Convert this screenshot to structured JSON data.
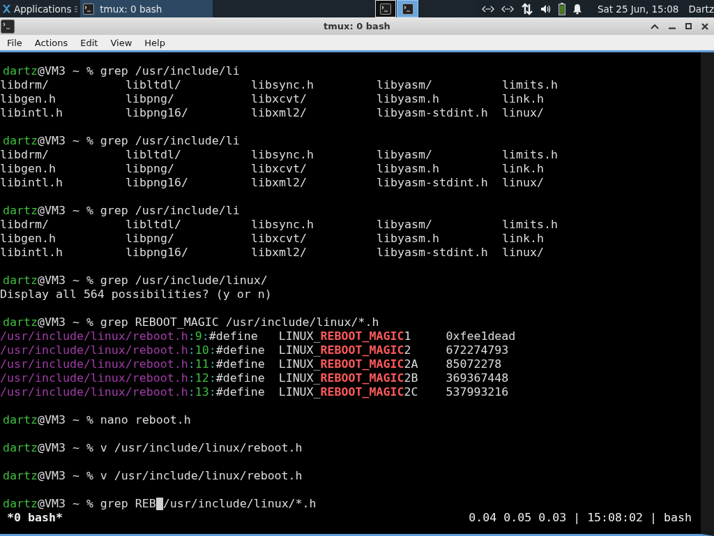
{
  "panel": {
    "app_menu": "Applications",
    "tasks": [
      {
        "title": "tmux: 0 bash",
        "selected": true
      }
    ],
    "workspaces": [
      {
        "selected": false
      },
      {
        "selected": true
      }
    ],
    "clock": "Sat 25 Jun, 15:08",
    "user": "Dartz"
  },
  "window": {
    "title": "tmux: 0 bash",
    "menu": [
      "File",
      "Actions",
      "Edit",
      "View",
      "Help"
    ]
  },
  "terminal": {
    "lines": [
      {
        "kind": "text",
        "segments": [
          {
            "kind": "user",
            "text": "dartz"
          },
          {
            "kind": "plain",
            "text": "@VM3 ~ % grep /usr/include/li"
          }
        ]
      },
      {
        "kind": "listing",
        "cells": [
          "libdrm/",
          "libltdl/",
          "libsync.h",
          "libyasm/",
          "limits.h"
        ]
      },
      {
        "kind": "listing",
        "cells": [
          "libgen.h",
          "libpng/",
          "libxcvt/",
          "libyasm.h",
          "link.h"
        ]
      },
      {
        "kind": "listing",
        "cells": [
          "libintl.h",
          "libpng16/",
          "libxml2/",
          "libyasm-stdint.h",
          "linux/"
        ]
      },
      {
        "kind": "blank"
      },
      {
        "kind": "text",
        "segments": [
          {
            "kind": "user",
            "text": "dartz"
          },
          {
            "kind": "plain",
            "text": "@VM3 ~ % grep /usr/include/li"
          }
        ]
      },
      {
        "kind": "listing",
        "cells": [
          "libdrm/",
          "libltdl/",
          "libsync.h",
          "libyasm/",
          "limits.h"
        ]
      },
      {
        "kind": "listing",
        "cells": [
          "libgen.h",
          "libpng/",
          "libxcvt/",
          "libyasm.h",
          "link.h"
        ]
      },
      {
        "kind": "listing",
        "cells": [
          "libintl.h",
          "libpng16/",
          "libxml2/",
          "libyasm-stdint.h",
          "linux/"
        ]
      },
      {
        "kind": "blank"
      },
      {
        "kind": "text",
        "segments": [
          {
            "kind": "user",
            "text": "dartz"
          },
          {
            "kind": "plain",
            "text": "@VM3 ~ % grep /usr/include/li"
          }
        ]
      },
      {
        "kind": "listing",
        "cells": [
          "libdrm/",
          "libltdl/",
          "libsync.h",
          "libyasm/",
          "limits.h"
        ]
      },
      {
        "kind": "listing",
        "cells": [
          "libgen.h",
          "libpng/",
          "libxcvt/",
          "libyasm.h",
          "link.h"
        ]
      },
      {
        "kind": "listing",
        "cells": [
          "libintl.h",
          "libpng16/",
          "libxml2/",
          "libyasm-stdint.h",
          "linux/"
        ]
      },
      {
        "kind": "blank"
      },
      {
        "kind": "text",
        "segments": [
          {
            "kind": "user",
            "text": "dartz"
          },
          {
            "kind": "plain",
            "text": "@VM3 ~ % grep /usr/include/linux/"
          }
        ]
      },
      {
        "kind": "text",
        "segments": [
          {
            "kind": "plain",
            "text": "Display all 564 possibilities? (y or n)"
          }
        ]
      },
      {
        "kind": "blank"
      },
      {
        "kind": "text",
        "segments": [
          {
            "kind": "user",
            "text": "dartz"
          },
          {
            "kind": "plain",
            "text": "@VM3 ~ % grep REBOOT_MAGIC /usr/include/linux/*.h"
          }
        ]
      },
      {
        "kind": "text",
        "segments": [
          {
            "kind": "path",
            "text": "/usr/include/linux/reboot.h"
          },
          {
            "kind": "sep",
            "text": ":"
          },
          {
            "kind": "linenum",
            "text": "9"
          },
          {
            "kind": "sep",
            "text": ":"
          },
          {
            "kind": "plain",
            "text": "#define   LINUX_"
          },
          {
            "kind": "match",
            "text": "REBOOT_MAGIC"
          },
          {
            "kind": "plain",
            "text": "1     0xfee1dead"
          }
        ]
      },
      {
        "kind": "text",
        "segments": [
          {
            "kind": "path",
            "text": "/usr/include/linux/reboot.h"
          },
          {
            "kind": "sep",
            "text": ":"
          },
          {
            "kind": "linenum",
            "text": "10"
          },
          {
            "kind": "sep",
            "text": ":"
          },
          {
            "kind": "plain",
            "text": "#define  LINUX_"
          },
          {
            "kind": "match",
            "text": "REBOOT_MAGIC"
          },
          {
            "kind": "plain",
            "text": "2     672274793"
          }
        ]
      },
      {
        "kind": "text",
        "segments": [
          {
            "kind": "path",
            "text": "/usr/include/linux/reboot.h"
          },
          {
            "kind": "sep",
            "text": ":"
          },
          {
            "kind": "linenum",
            "text": "11"
          },
          {
            "kind": "sep",
            "text": ":"
          },
          {
            "kind": "plain",
            "text": "#define  LINUX_"
          },
          {
            "kind": "match",
            "text": "REBOOT_MAGIC"
          },
          {
            "kind": "plain",
            "text": "2A    85072278"
          }
        ]
      },
      {
        "kind": "text",
        "segments": [
          {
            "kind": "path",
            "text": "/usr/include/linux/reboot.h"
          },
          {
            "kind": "sep",
            "text": ":"
          },
          {
            "kind": "linenum",
            "text": "12"
          },
          {
            "kind": "sep",
            "text": ":"
          },
          {
            "kind": "plain",
            "text": "#define  LINUX_"
          },
          {
            "kind": "match",
            "text": "REBOOT_MAGIC"
          },
          {
            "kind": "plain",
            "text": "2B    369367448"
          }
        ]
      },
      {
        "kind": "text",
        "segments": [
          {
            "kind": "path",
            "text": "/usr/include/linux/reboot.h"
          },
          {
            "kind": "sep",
            "text": ":"
          },
          {
            "kind": "linenum",
            "text": "13"
          },
          {
            "kind": "sep",
            "text": ":"
          },
          {
            "kind": "plain",
            "text": "#define  LINUX_"
          },
          {
            "kind": "match",
            "text": "REBOOT_MAGIC"
          },
          {
            "kind": "plain",
            "text": "2C    537993216"
          }
        ]
      },
      {
        "kind": "blank"
      },
      {
        "kind": "text",
        "segments": [
          {
            "kind": "user",
            "text": "dartz"
          },
          {
            "kind": "plain",
            "text": "@VM3 ~ % nano reboot.h"
          }
        ]
      },
      {
        "kind": "blank"
      },
      {
        "kind": "text",
        "segments": [
          {
            "kind": "user",
            "text": "dartz"
          },
          {
            "kind": "plain",
            "text": "@VM3 ~ % v /usr/include/linux/reboot.h"
          }
        ]
      },
      {
        "kind": "blank"
      },
      {
        "kind": "text",
        "segments": [
          {
            "kind": "user",
            "text": "dartz"
          },
          {
            "kind": "plain",
            "text": "@VM3 ~ % v /usr/include/linux/reboot.h"
          }
        ]
      },
      {
        "kind": "blank"
      },
      {
        "kind": "text",
        "segments": [
          {
            "kind": "user",
            "text": "dartz"
          },
          {
            "kind": "plain",
            "text": "@VM3 ~ % grep REB"
          },
          {
            "kind": "cursor"
          },
          {
            "kind": "plain",
            "text": "/usr/include/linux/*.h"
          }
        ]
      }
    ],
    "status": {
      "session": "*0 bash*",
      "info": "0.04 0.05 0.03 | 15:08:02 | bash"
    }
  }
}
